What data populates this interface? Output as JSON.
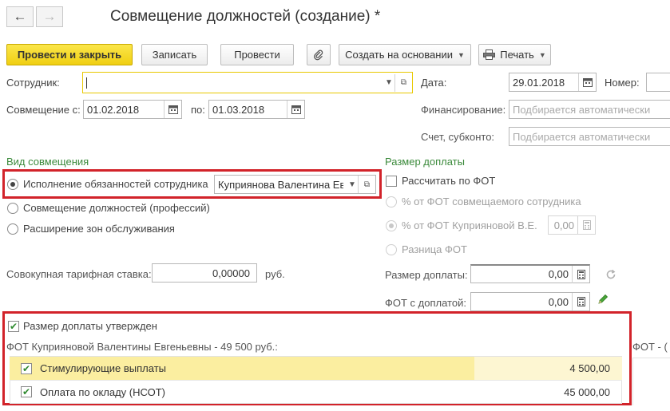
{
  "header": {
    "title": "Совмещение должностей (создание) *",
    "back_icon": "←",
    "forward_icon": "→"
  },
  "toolbar": {
    "post_close": "Провести и закрыть",
    "save": "Записать",
    "post": "Провести",
    "create_based": "Создать на основании",
    "print": "Печать"
  },
  "form": {
    "employee_label": "Сотрудник:",
    "employee_value": "",
    "date_label": "Дата:",
    "date_value": "29.01.2018",
    "number_label": "Номер:",
    "combo_from_label": "Совмещение с:",
    "combo_from_value": "01.02.2018",
    "combo_to_label": "по:",
    "combo_to_value": "01.03.2018",
    "financing_label": "Финансирование:",
    "financing_placeholder": "Подбирается автоматически",
    "account_label": "Счет, субконто:",
    "account_placeholder": "Подбирается автоматически"
  },
  "combo_type": {
    "section_title": "Вид совмещения",
    "option1": "Исполнение обязанностей сотрудника",
    "option1_employee": "Куприянова Валентина Ев",
    "option2": "Совмещение должностей (профессий)",
    "option3": "Расширение зон обслуживания",
    "selected": 1
  },
  "rate": {
    "label": "Совокупная тарифная ставка:",
    "value": "0,00000",
    "unit": "руб."
  },
  "surcharge": {
    "section_title": "Размер доплаты",
    "calc_fot": "Рассчитать по ФОТ",
    "pct_combined": "% от ФОТ совмещаемого сотрудника",
    "pct_employee": "% от ФОТ Куприяновой В.Е.",
    "pct_employee_value": "0,00",
    "difference": "Разница ФОТ",
    "size_label": "Размер доплаты:",
    "size_value": "0,00",
    "fot_with_label": "ФОТ с доплатой:",
    "fot_with_value": "0,00"
  },
  "approved": {
    "checkbox_label": "Размер доплаты утвержден",
    "fot_text": "ФОТ Куприяновой Валентины Евгеньевны - 49 500 руб.:",
    "right_text": "ФОТ  -  (",
    "rows": [
      {
        "name": "Стимулирующие выплаты",
        "amount": "4 500,00"
      },
      {
        "name": "Оплата по окладу (НСОТ)",
        "amount": "45 000,00"
      }
    ]
  },
  "colors": {
    "accent_yellow": "#f5d81f",
    "highlight_red": "#d2232a",
    "section_green": "#3b8a3b"
  }
}
